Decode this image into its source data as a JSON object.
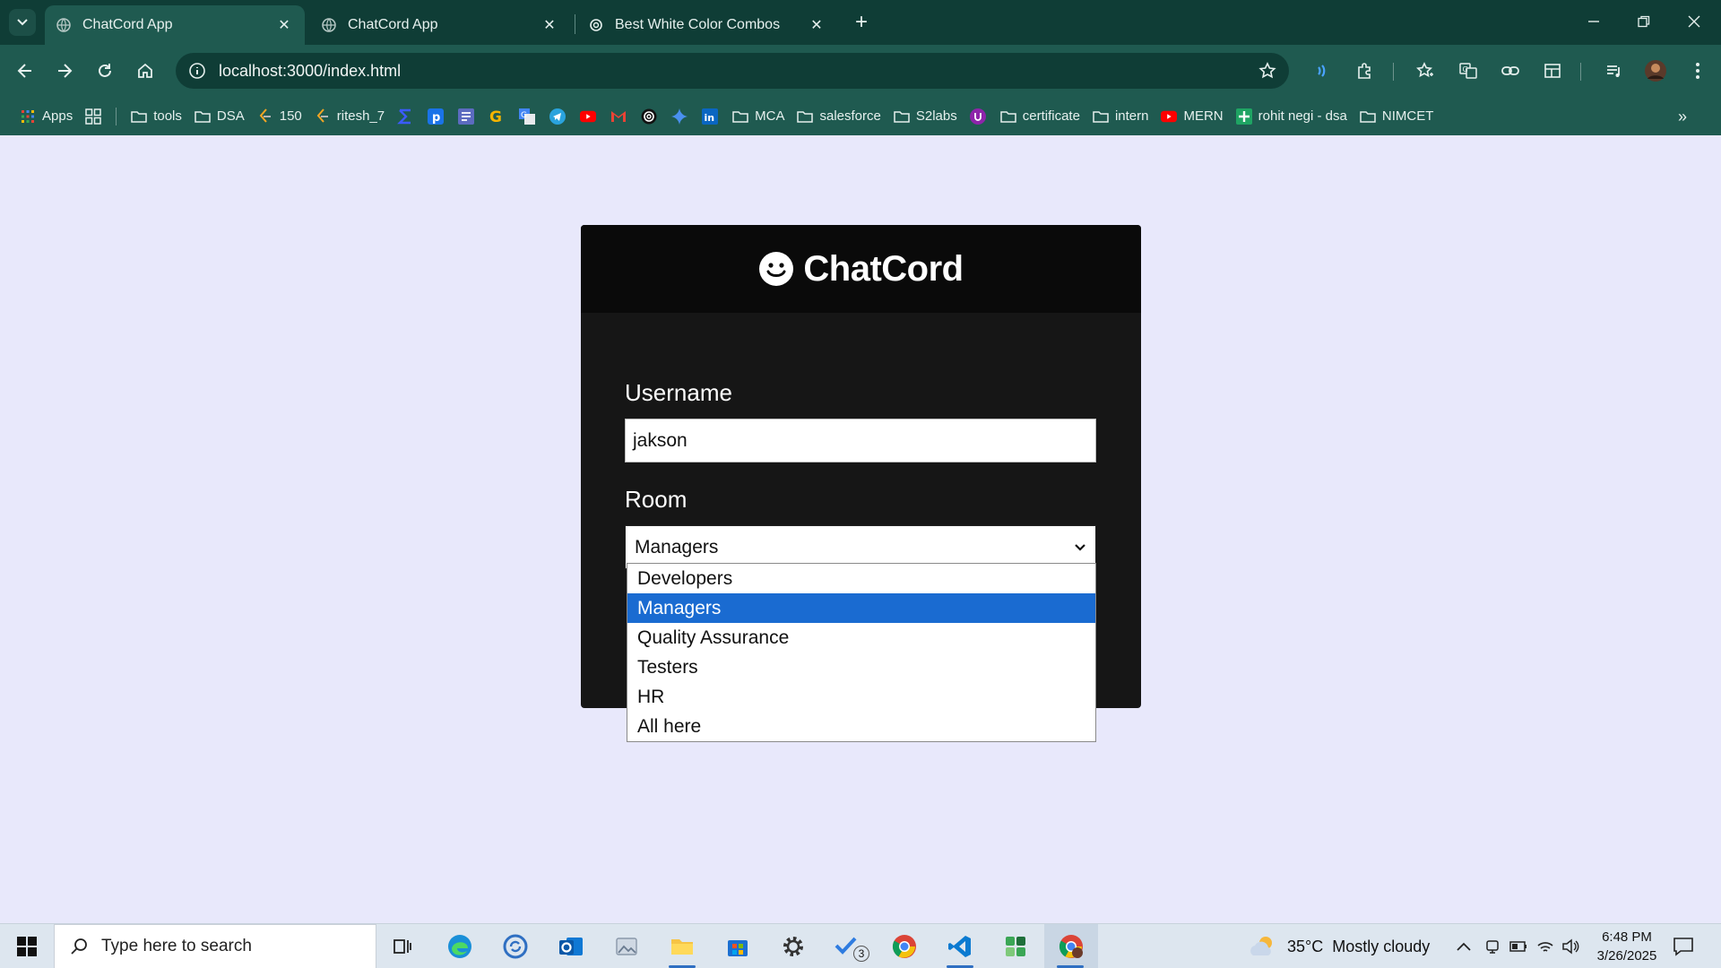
{
  "browser": {
    "tabs": [
      {
        "title": "ChatCord App",
        "active": true
      },
      {
        "title": "ChatCord App",
        "active": false
      },
      {
        "title": "Best White Color Combos",
        "active": false
      }
    ],
    "address": "localhost:3000/index.html",
    "bookmarks": [
      {
        "label": "Apps",
        "icon": "apps-grid-icon"
      },
      {
        "label": "",
        "icon": "tab-groups-icon"
      },
      {
        "label": "tools",
        "icon": "folder-icon"
      },
      {
        "label": "DSA",
        "icon": "folder-icon"
      },
      {
        "label": "150",
        "icon": "leetcode-icon"
      },
      {
        "label": "ritesh_7",
        "icon": "leetcode-icon"
      },
      {
        "label": "",
        "icon": "sigma-icon"
      },
      {
        "label": "",
        "icon": "p-app-icon"
      },
      {
        "label": "",
        "icon": "forms-icon"
      },
      {
        "label": "",
        "icon": "google-icon"
      },
      {
        "label": "",
        "icon": "translate-icon"
      },
      {
        "label": "",
        "icon": "telegram-icon"
      },
      {
        "label": "",
        "icon": "youtube-icon"
      },
      {
        "label": "",
        "icon": "gmail-icon"
      },
      {
        "label": "",
        "icon": "openai-icon"
      },
      {
        "label": "",
        "icon": "gemini-icon"
      },
      {
        "label": "",
        "icon": "linkedin-icon"
      },
      {
        "label": "MCA",
        "icon": "folder-icon"
      },
      {
        "label": "salesforce",
        "icon": "folder-icon"
      },
      {
        "label": "S2labs",
        "icon": "folder-icon"
      },
      {
        "label": "",
        "icon": "purple-app-icon"
      },
      {
        "label": "certificate",
        "icon": "folder-icon"
      },
      {
        "label": "intern",
        "icon": "folder-icon"
      },
      {
        "label": "MERN",
        "icon": "youtube-icon"
      },
      {
        "label": "rohit negi - dsa",
        "icon": "plus-sheet-icon"
      },
      {
        "label": "NIMCET",
        "icon": "folder-icon"
      }
    ]
  },
  "app": {
    "brand": "ChatCord",
    "username_label": "Username",
    "username_value": "jakson",
    "room_label": "Room",
    "room_selected": "Managers",
    "room_options": [
      "Developers",
      "Managers",
      "Quality Assurance",
      "Testers",
      "HR",
      "All here"
    ],
    "accent": "#1a6bd1"
  },
  "taskbar": {
    "search_placeholder": "Type here to search",
    "weather_temp": "35°C",
    "weather_desc": "Mostly cloudy",
    "time": "6:48 PM",
    "date": "3/26/2025",
    "todo_badge": "3"
  }
}
